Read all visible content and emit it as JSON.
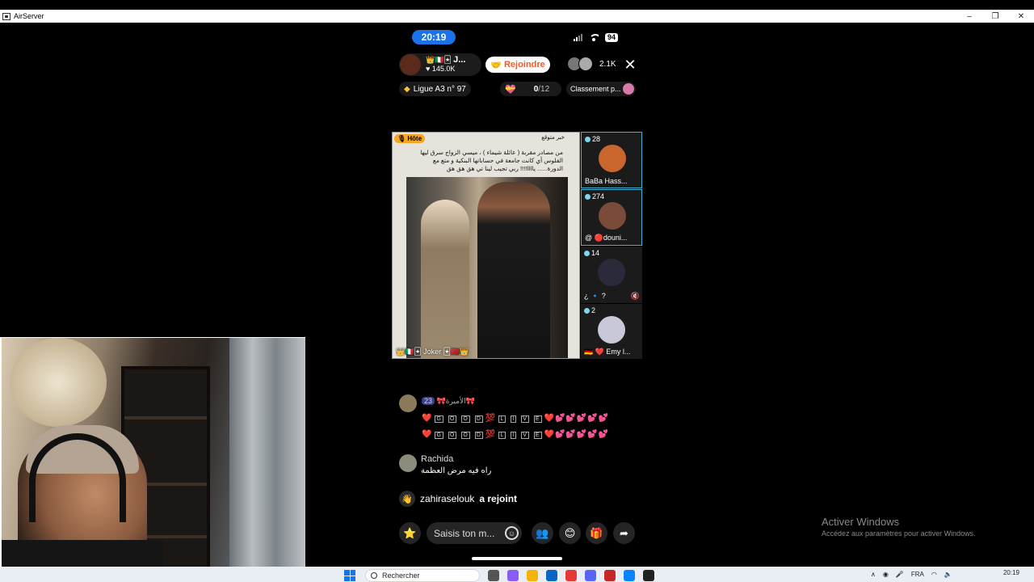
{
  "window": {
    "title": "AirServer",
    "controls": [
      "–",
      "❐",
      "✕"
    ]
  },
  "status": {
    "time": "20:19",
    "battery": "94"
  },
  "live_header": {
    "host_badges": "👑🇮🇹🃏",
    "host_name": "J...",
    "host_likes": "♥ 145.0K",
    "join_label": "Rejoindre",
    "viewer_count": "2.1K",
    "close": "✕"
  },
  "info_row": {
    "league": "Ligue A3 n° 97",
    "gift_value": "0",
    "gift_total": "/12",
    "ranking": "Classement p..."
  },
  "main_video": {
    "host_tag": "Hôte",
    "headline": "خبر متوقع",
    "news_text": "من مصادر مقربة ( عائلة شيماء ) ، ميسي الزواج سرق ليها الفلوس أي كانت جامعة في حساباتها البنكية و متع مع الدورة...... ياااا!!!! ربي تجيب لينا تي هق هق هق",
    "host_label": "👑🇮🇹🃏 Joker 🃏🇲🇦👑"
  },
  "side_tiles": [
    {
      "count": "28",
      "name": "BaBa Hass...",
      "color": "#d0703a"
    },
    {
      "count": "274",
      "name": "@ 🔴douni...",
      "color": "#7a4a3a"
    },
    {
      "count": "14",
      "name": "¿ 🔹 ?",
      "color": "#2a2a3a"
    },
    {
      "count": "2",
      "name": "🇩🇪 ❤️ Emy l...",
      "color": "#c8c8d8"
    }
  ],
  "chat": {
    "msg1_level": "23",
    "msg1_user": "🎀الأميرة🎀",
    "msg1_line": "❤️ G O O D 💯 L I V E ❤️💕💕💕💕💕",
    "msg1_letters_a": [
      "G",
      "O",
      "O",
      "D"
    ],
    "msg1_letters_b": [
      "L",
      "I",
      "V",
      "E"
    ],
    "msg2_name": "Rachida",
    "msg2_text": "راه فيه مرض العظمة",
    "msg3_user": "zahiraselouk",
    "msg3_action": "a rejoint"
  },
  "bottom_bar": {
    "input_placeholder": "Saisis ton m..."
  },
  "windows": {
    "activate_title": "Activer Windows",
    "activate_sub": "Accédez aux paramètres pour activer Windows.",
    "search_placeholder": "Rechercher",
    "lang": "FRA",
    "clock_time": "20:19"
  }
}
